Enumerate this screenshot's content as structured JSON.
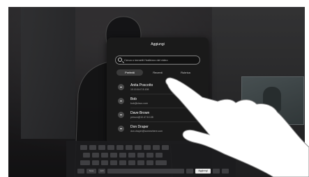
{
  "dialog": {
    "title": "Aggiungi",
    "search_placeholder": "Cerca o immetti l'indirizzo del video",
    "tabs": [
      {
        "label": "Preferiti",
        "active": true
      },
      {
        "label": "Recenti",
        "active": false
      },
      {
        "label": "Rubrica",
        "active": false
      }
    ],
    "contacts": [
      {
        "name": "Anita Poscotto",
        "address": "10.10.8.47.8.108"
      },
      {
        "name": "Bob",
        "address": "bob@cisco.com"
      },
      {
        "name": "Dave Brown",
        "address": "person@10.47.8.108"
      },
      {
        "name": "Don Draper",
        "address": "don.draper@somewhere.com"
      }
    ]
  },
  "keyboard": {
    "action_label": "Aggiungi",
    "mode_label": "123",
    "bottom_left_label": "Nota"
  },
  "colors": {
    "dialog_bg": "#1a1a1a",
    "active_tab_bg": "#3a3a3a",
    "action_key_bg": "#e8e8e8"
  }
}
